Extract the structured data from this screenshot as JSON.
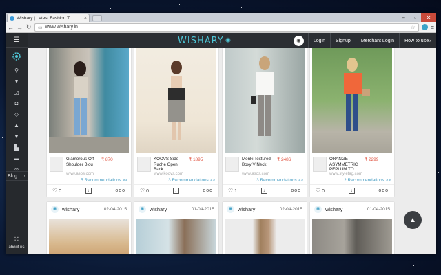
{
  "browser": {
    "tab_title": "Wishary | Latest Fashion T",
    "tab_close": "×",
    "url": "www.wishary.in",
    "win_min": "–",
    "win_max": "▫",
    "win_close": "✕"
  },
  "sidebar": {
    "blog_label": "Blog",
    "blog_arrow": "›",
    "about_label": "about us"
  },
  "topnav": {
    "brand": "WISHARY",
    "links": [
      "Login",
      "Signup",
      "Merchant Login",
      "How to use?"
    ]
  },
  "products": [
    {
      "name": "Glamorous Off Shoulder Blou",
      "price": "₹ 870",
      "site": "www.asos.com",
      "recommendations": "5 Recommendations >>",
      "likes": "0"
    },
    {
      "name": "KOOVS Side Ruche Open Back",
      "price": "₹ 1895",
      "site": "www.koovs.com",
      "recommendations": "3 Recommendations >>",
      "likes": "0"
    },
    {
      "name": "Monki Textured Boxy V Neck",
      "price": "₹ 2486",
      "site": "www.asos.com",
      "recommendations": "3 Recommendations >>",
      "likes": "1"
    },
    {
      "name": "ORANGE ASYMMETRIC PEPLUM TO",
      "price": "₹ 2299",
      "site": "www.styletag.com",
      "recommendations": "2 Recommendations >>",
      "likes": "0"
    }
  ],
  "blog_posts": [
    {
      "user": "wishary",
      "date": "02-04-2015"
    },
    {
      "user": "wishary",
      "date": "01-04-2015"
    },
    {
      "user": "wishary",
      "date": "02-04-2015"
    },
    {
      "user": "wishary",
      "date": "01-04-2015"
    }
  ],
  "colors": {
    "accent": "#4ec6d6",
    "price": "#e0523f",
    "link": "#4a9fc4",
    "sidebar": "#26292d",
    "topnav": "#2b2e33"
  }
}
